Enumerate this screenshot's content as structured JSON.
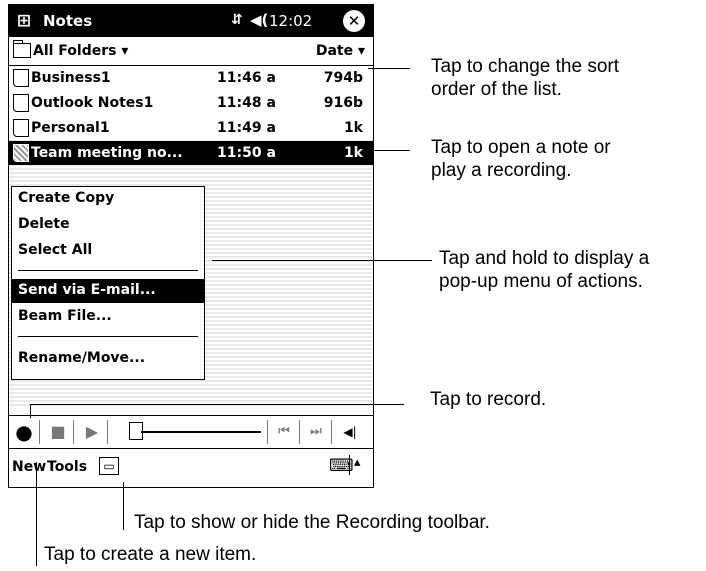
{
  "titlebar": {
    "app": "Notes",
    "signal_glyph": "⇵",
    "volume_glyph": "◀(",
    "time": "12:02",
    "close_glyph": "✕",
    "start_glyph": "⊞"
  },
  "folderbar": {
    "folder": "All Folders ▾",
    "sort": "Date ▾"
  },
  "notes": [
    {
      "name": "Business1",
      "time": "11:46 a",
      "size": "794b"
    },
    {
      "name": "Outlook Notes1",
      "time": "11:48 a",
      "size": "916b"
    },
    {
      "name": "Personal1",
      "time": "11:49 a",
      "size": "1k"
    },
    {
      "name": "Team meeting no...",
      "time": "11:50 a",
      "size": "1k"
    }
  ],
  "context_menu": {
    "create_copy": "Create Copy",
    "delete": "Delete",
    "select_all": "Select All",
    "send_email": "Send via E-mail...",
    "beam_file": "Beam File...",
    "rename_move": "Rename/Move..."
  },
  "recording_toolbar": {
    "record": "●",
    "stop": "■",
    "play": "▶",
    "prev": "⏮",
    "next": "⏭",
    "volume": "◀|"
  },
  "menubar": {
    "new": "New",
    "tools": "Tools",
    "recording_button": "▭",
    "keyboard": "⌨",
    "up_arrow": "▴"
  },
  "callouts": {
    "sort": [
      "Tap to change the sort",
      "order of the list."
    ],
    "open": [
      "Tap to open a note or",
      "play a recording."
    ],
    "hold": [
      "Tap and hold to display a",
      "pop-up menu of actions."
    ],
    "record": "Tap to record.",
    "toolbar": "Tap to show or hide the Recording toolbar.",
    "new_item": "Tap to create a new item."
  }
}
